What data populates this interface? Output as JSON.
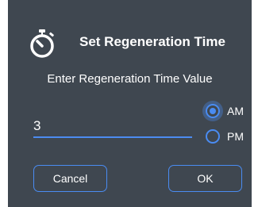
{
  "dialog": {
    "title": "Set Regeneration Time",
    "icon": "stopwatch-icon",
    "prompt": "Enter Regeneration Time Value",
    "input": {
      "value": "3",
      "placeholder": ""
    },
    "radio": {
      "options": [
        {
          "label": "AM",
          "selected": true
        },
        {
          "label": "PM",
          "selected": false
        }
      ]
    },
    "buttons": {
      "cancel_label": "Cancel",
      "ok_label": "OK"
    }
  },
  "colors": {
    "background": "#3f4750",
    "accent": "#4a8cf2",
    "text": "#ffffff"
  }
}
